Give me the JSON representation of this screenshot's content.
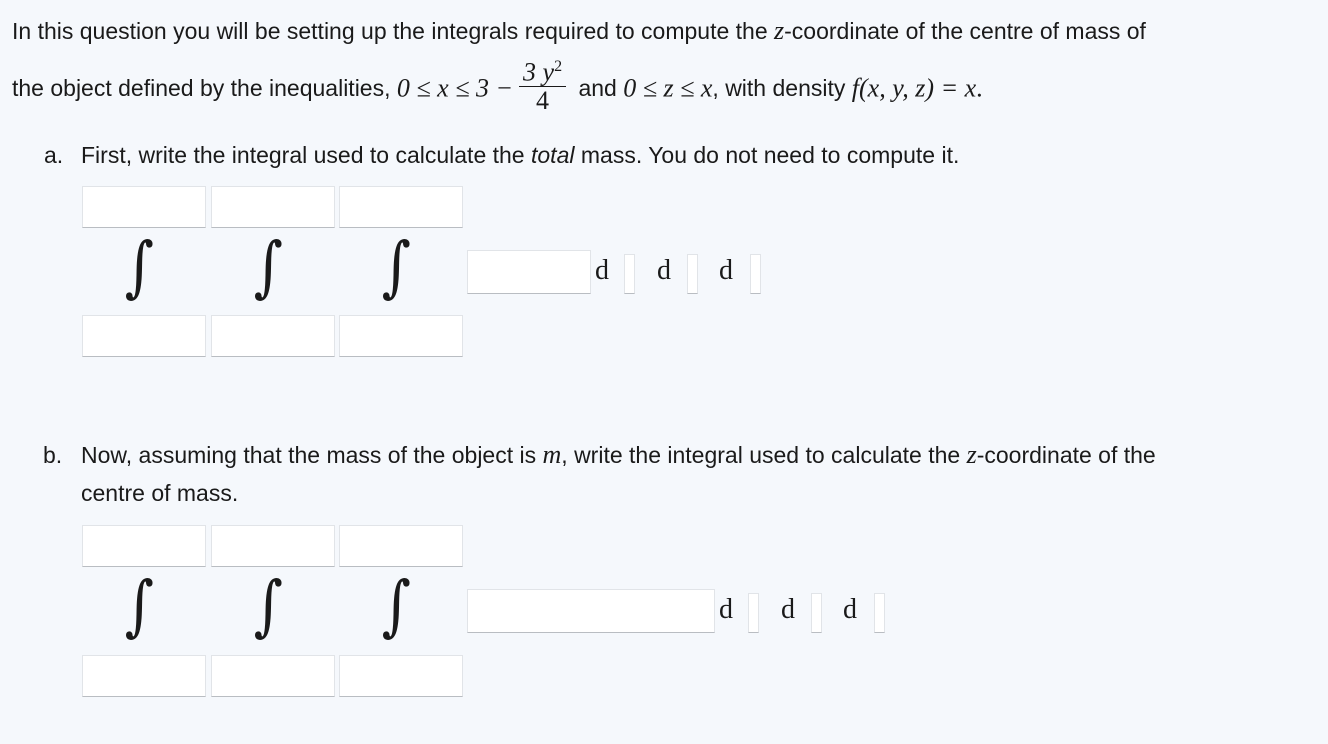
{
  "intro": {
    "line1_a": "In this question you will be setting up the integrals required to compute the ",
    "line1_var": "z",
    "line1_b": "-coordinate of the centre of mass of",
    "line2_a": "the object defined by the inequalities, ",
    "ineq1": "0 ≤ x ≤ 3 −",
    "frac_num": "3 y",
    "frac_exp": "2",
    "frac_den": "4",
    "line2_and": " and ",
    "ineq2": "0 ≤ z ≤ x",
    "line2_with": ", with density ",
    "density": "f(x, y, z) = x",
    "line2_end": "."
  },
  "part_a": {
    "marker": "a.",
    "text_a": "First, write the integral used to calculate the ",
    "text_em": "total",
    "text_b": " mass. You do not need to compute it.",
    "integral_symbol": "∫",
    "d_label": "d",
    "fields": {
      "upper1": "",
      "upper2": "",
      "upper3": "",
      "lower1": "",
      "lower2": "",
      "lower3": "",
      "integrand": "",
      "var1": "",
      "var2": "",
      "var3": ""
    }
  },
  "part_b": {
    "marker": "b.",
    "text_a": "Now, assuming that the mass of the object is ",
    "text_var": "m",
    "text_b": ", write the integral used to calculate the ",
    "text_var2": "z",
    "text_c": "-coordinate of the",
    "text_line2": "centre of mass.",
    "integral_symbol": "∫",
    "d_label": "d",
    "fields": {
      "upper1": "",
      "upper2": "",
      "upper3": "",
      "lower1": "",
      "lower2": "",
      "lower3": "",
      "integrand": "",
      "var1": "",
      "var2": "",
      "var3": ""
    }
  }
}
